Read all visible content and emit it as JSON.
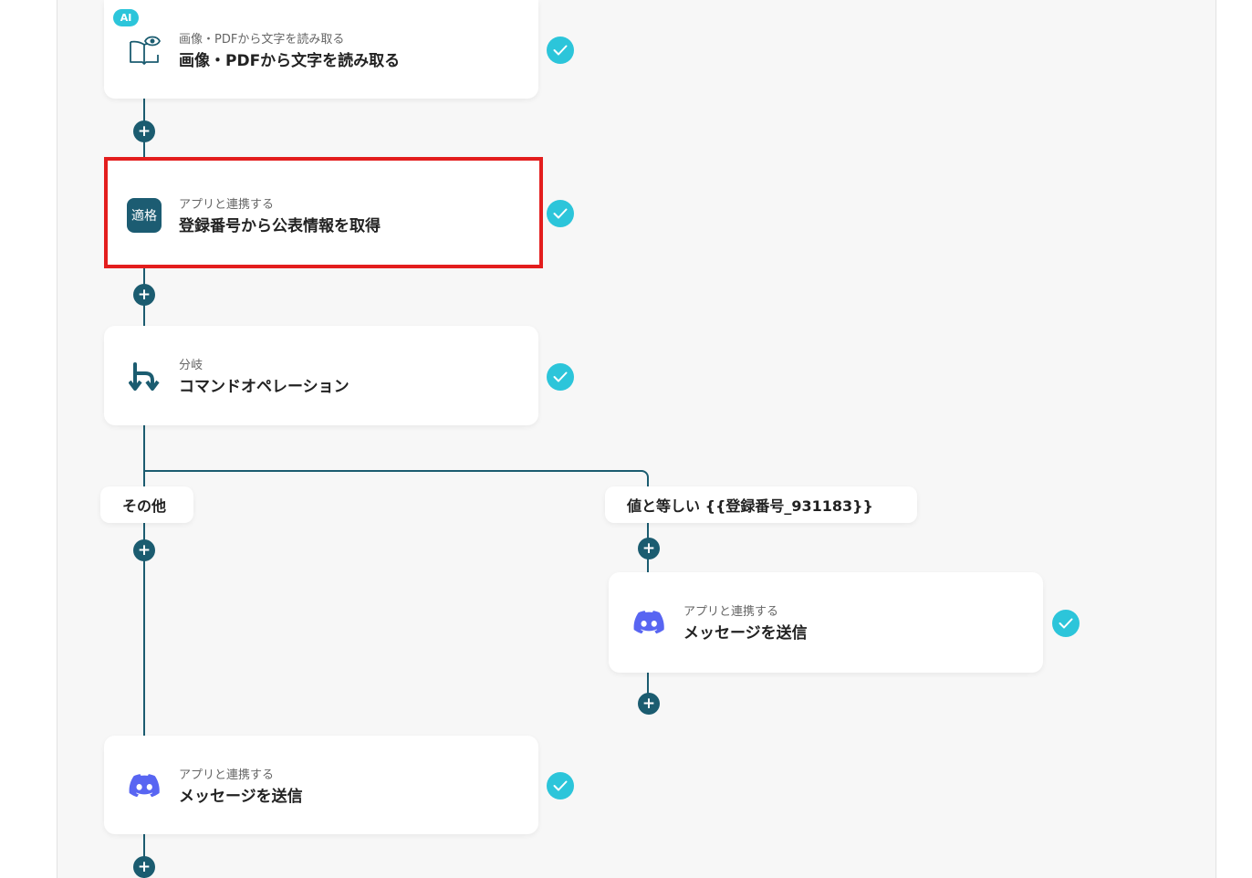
{
  "flow": {
    "steps": [
      {
        "badge": "AI",
        "sub": "画像・PDFから文字を読み取る",
        "title": "画像・PDFから文字を読み取る",
        "icon": "book-eye-icon",
        "status": "completed"
      },
      {
        "sub": "アプリと連携する",
        "title": "登録番号から公表情報を取得",
        "icon": "tekikaku-app-icon",
        "icon_text": "適格",
        "status": "completed",
        "highlighted": true
      },
      {
        "sub": "分岐",
        "title": "コマンドオペレーション",
        "icon": "branch-icon",
        "status": "completed"
      },
      {
        "sub": "アプリと連携する",
        "title": "メッセージを送信",
        "icon": "discord-icon",
        "status": "completed"
      },
      {
        "sub": "アプリと連携する",
        "title": "メッセージを送信",
        "icon": "discord-icon",
        "status": "completed"
      }
    ],
    "branches": {
      "other": "その他",
      "equals": "値と等しい {{登録番号_931183}}"
    },
    "add_step_symbol": "+"
  },
  "colors": {
    "connector": "#1b5c70",
    "check": "#2cc5da",
    "highlight": "#e31d1d",
    "discord": "#5865f2",
    "canvas": "#f7f7f7"
  }
}
